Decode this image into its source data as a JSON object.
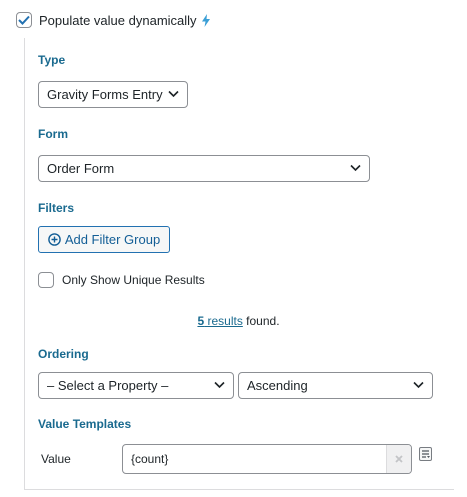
{
  "dynamic": {
    "checked": true,
    "label": "Populate value dynamically"
  },
  "type_section": {
    "label": "Type",
    "selected": "Gravity Forms Entry"
  },
  "form_section": {
    "label": "Form",
    "selected": "Order Form"
  },
  "filters_section": {
    "label": "Filters",
    "add_button": "Add Filter Group"
  },
  "unique": {
    "checked": false,
    "label": "Only Show Unique Results"
  },
  "results": {
    "count": "5",
    "link_word": "results",
    "suffix": "found."
  },
  "ordering_section": {
    "label": "Ordering",
    "property": "– Select a Property –",
    "direction": "Ascending"
  },
  "templates_section": {
    "label": "Value Templates",
    "row_label": "Value",
    "value": "{count}"
  },
  "colors": {
    "accent": "#2271b1",
    "section_label": "#1a6a8f",
    "border": "#8c8f94"
  }
}
